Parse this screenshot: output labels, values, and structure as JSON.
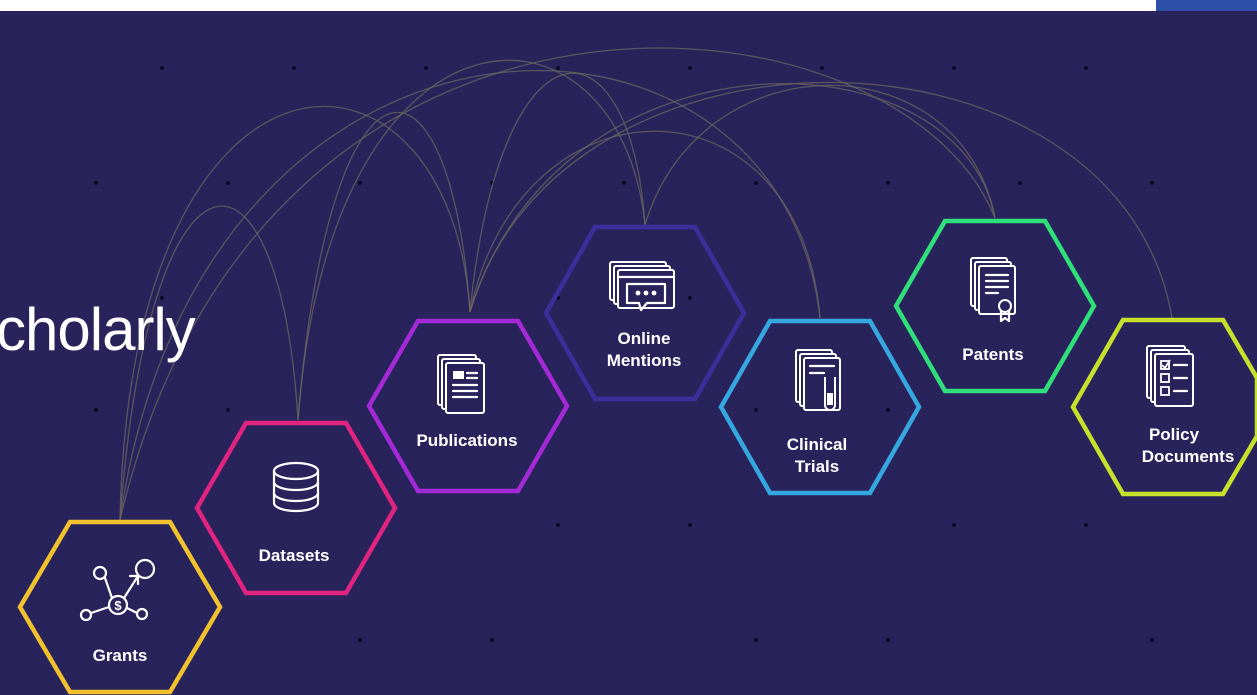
{
  "heading": "cholarly",
  "colors": {
    "background": "#29235c",
    "grants": "#f2c12e",
    "datasets": "#e0247f",
    "publications": "#a32ad6",
    "online_mentions": "#3d2f9b",
    "clinical_trials": "#36a8e0",
    "patents": "#2fe07a",
    "policy_documents": "#c6e02b"
  },
  "nodes": {
    "grants": {
      "label": "Grants",
      "icon": "grants-network-icon"
    },
    "datasets": {
      "label": "Datasets",
      "icon": "database-icon"
    },
    "publications": {
      "label": "Publications",
      "icon": "document-stack-icon"
    },
    "online_mentions": {
      "line1": "Online",
      "line2": "Mentions",
      "icon": "browser-chat-icon"
    },
    "clinical_trials": {
      "line1": "Clinical",
      "line2": "Trials",
      "icon": "test-tube-document-icon"
    },
    "patents": {
      "label": "Patents",
      "icon": "certificate-icon"
    },
    "policy_documents": {
      "line1": "Policy",
      "line2": "Documents",
      "icon": "checklist-icon"
    }
  }
}
